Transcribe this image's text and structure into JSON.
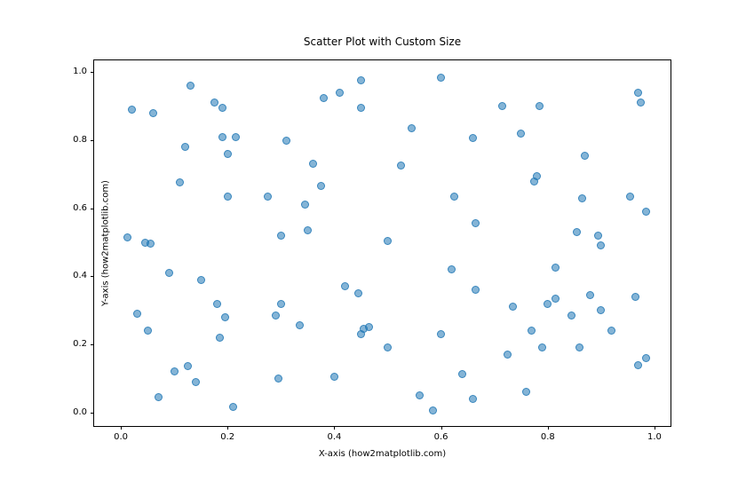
{
  "chart_data": {
    "type": "scatter",
    "title": "Scatter Plot with Custom Size",
    "xlabel": "X-axis (how2matplotlib.com)",
    "ylabel": "Y-axis (how2matplotlib.com)",
    "xlim": [
      -0.05,
      1.03
    ],
    "ylim": [
      -0.04,
      1.035
    ],
    "xticks": [
      0.0,
      0.2,
      0.4,
      0.6,
      0.8,
      1.0
    ],
    "yticks": [
      0.0,
      0.2,
      0.4,
      0.6,
      0.8,
      1.0
    ],
    "x": [
      0.012,
      0.02,
      0.03,
      0.045,
      0.05,
      0.055,
      0.06,
      0.07,
      0.09,
      0.1,
      0.11,
      0.12,
      0.125,
      0.13,
      0.14,
      0.15,
      0.175,
      0.18,
      0.185,
      0.19,
      0.19,
      0.195,
      0.2,
      0.2,
      0.21,
      0.215,
      0.275,
      0.29,
      0.295,
      0.3,
      0.3,
      0.31,
      0.335,
      0.345,
      0.35,
      0.36,
      0.375,
      0.38,
      0.4,
      0.41,
      0.42,
      0.45,
      0.445,
      0.45,
      0.45,
      0.455,
      0.465,
      0.5,
      0.5,
      0.525,
      0.545,
      0.56,
      0.585,
      0.6,
      0.6,
      0.62,
      0.625,
      0.64,
      0.66,
      0.66,
      0.665,
      0.665,
      0.715,
      0.725,
      0.735,
      0.75,
      0.76,
      0.77,
      0.775,
      0.78,
      0.785,
      0.79,
      0.8,
      0.815,
      0.815,
      0.845,
      0.855,
      0.86,
      0.865,
      0.87,
      0.88,
      0.9,
      0.9,
      0.895,
      0.92,
      0.955,
      0.965,
      0.97,
      0.97,
      0.975,
      0.985,
      0.985
    ],
    "y": [
      0.515,
      0.89,
      0.29,
      0.5,
      0.24,
      0.495,
      0.88,
      0.045,
      0.41,
      0.12,
      0.675,
      0.78,
      0.135,
      0.96,
      0.09,
      0.39,
      0.91,
      0.32,
      0.22,
      0.81,
      0.895,
      0.28,
      0.635,
      0.76,
      0.015,
      0.81,
      0.635,
      0.285,
      0.1,
      0.32,
      0.52,
      0.8,
      0.255,
      0.61,
      0.535,
      0.73,
      0.665,
      0.925,
      0.105,
      0.94,
      0.37,
      0.895,
      0.35,
      0.975,
      0.23,
      0.245,
      0.25,
      0.19,
      0.505,
      0.725,
      0.835,
      0.05,
      0.005,
      0.23,
      0.985,
      0.42,
      0.635,
      0.113,
      0.807,
      0.04,
      0.555,
      0.36,
      0.9,
      0.17,
      0.31,
      0.82,
      0.06,
      0.24,
      0.68,
      0.695,
      0.9,
      0.19,
      0.32,
      0.335,
      0.425,
      0.285,
      0.53,
      0.19,
      0.63,
      0.755,
      0.345,
      0.3,
      0.49,
      0.52,
      0.24,
      0.635,
      0.34,
      0.14,
      0.94,
      0.91,
      0.16,
      0.59
    ]
  }
}
